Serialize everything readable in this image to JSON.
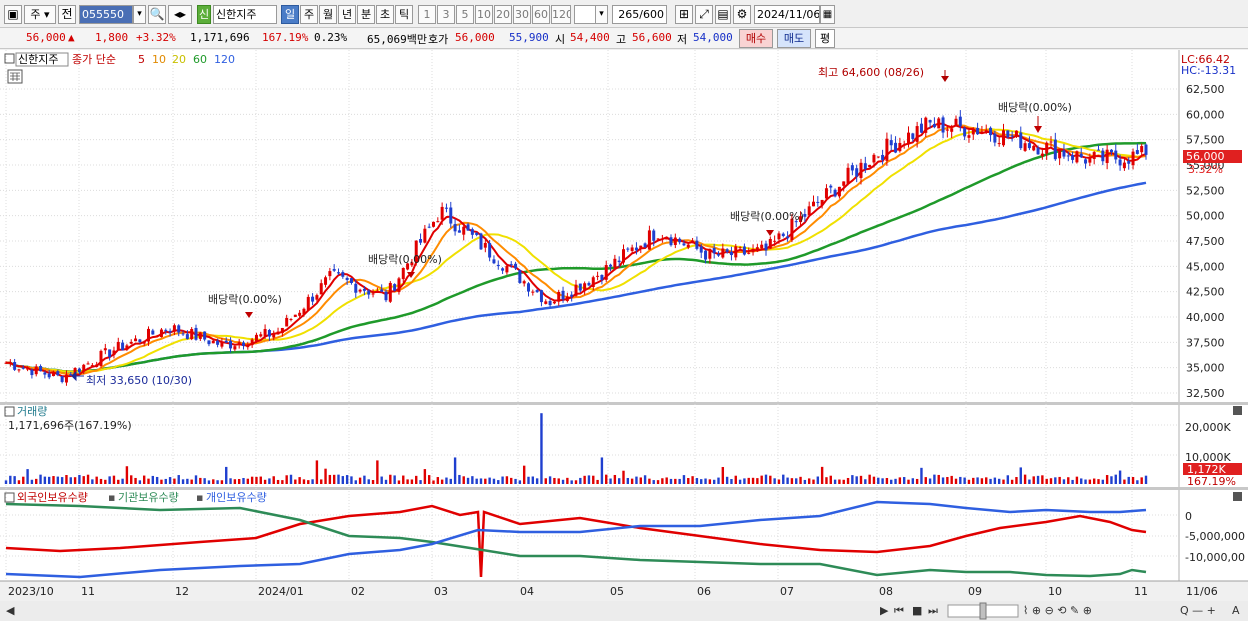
{
  "toolbar": {
    "period_toggle": "주",
    "prev_label": "전",
    "stock_code": "055550",
    "stock_badge": "신",
    "stock_name": "신한지주",
    "periods": [
      "일",
      "주",
      "월",
      "년",
      "분",
      "초",
      "틱"
    ],
    "minute_opts": [
      "1",
      "3",
      "5",
      "10",
      "20",
      "30",
      "60",
      "120"
    ],
    "count": "265",
    "count_total": "/600",
    "date": "2024/11/06"
  },
  "quote": {
    "price": "56,000",
    "arrow": "▲",
    "change": "1,800",
    "change_pct": "+3.32%",
    "volume": "1,171,696",
    "vol_ratio": "167.19%",
    "turnover_pct": "0.23%",
    "amount": "65,069백만",
    "bid_label": "호가",
    "ask": "56,000",
    "bid": "55,900",
    "open_label": "시",
    "open": "54,400",
    "high_label": "고",
    "high": "56,600",
    "low_label": "저",
    "low": "54,000",
    "buy": "매수",
    "sell": "매도",
    "eval": "평"
  },
  "panes": {
    "price": {
      "name": "신한지주",
      "indicator": "종가 단순",
      "ma_labels": [
        "5",
        "10",
        "20",
        "60",
        "120"
      ],
      "lc": "LC:66.42",
      "hc": "HC:-13.31",
      "last_price": "56,000",
      "last_pct": "3.32%",
      "annotations": {
        "high": "최고 64,600 (08/26)",
        "low": "최저 33,650 (10/30)",
        "dividends": [
          "배당락(0.00%)",
          "배당락(0.00%)",
          "배당락(0.00%)",
          "배당락(0.00%)"
        ]
      }
    },
    "volume": {
      "title": "거래량",
      "info": "1,171,696주(167.19%)",
      "last": "1,172K",
      "last_pct": "167.19%"
    },
    "holders": {
      "labels": [
        "외국인보유수량",
        "기관보유수량",
        "개인보유수량"
      ]
    }
  },
  "colors": {
    "up": "#e00000",
    "down": "#1f3fcf",
    "ma5": "#e00000",
    "ma10": "#ff8c00",
    "ma20": "#f0e000",
    "ma60": "#1f9a2a",
    "ma120": "#2f5fe0",
    "foreign": "#e00000",
    "inst": "#2e8b57",
    "indiv": "#2f5fe0"
  },
  "chart_data": [
    {
      "type": "candlestick",
      "title": "신한지주",
      "x_ticks": [
        "2023/10",
        "11",
        "12",
        "2024/01",
        "02",
        "03",
        "04",
        "05",
        "06",
        "07",
        "08",
        "09",
        "10",
        "11",
        "11/06"
      ],
      "y_ticks": [
        "32,500",
        "35,000",
        "37,500",
        "40,000",
        "42,500",
        "45,000",
        "47,500",
        "50,000",
        "52,500",
        "55,000",
        "57,500",
        "60,000",
        "62,500"
      ],
      "ylim": [
        32500,
        66000
      ],
      "series": [
        {
          "name": "close_anchor",
          "points": [
            [
              "2023/10",
              35500
            ],
            [
              "2023/11 mid",
              34000
            ],
            [
              "2023/12",
              36800
            ],
            [
              "2024/01",
              39000
            ],
            [
              "2024/01 mid",
              37200
            ],
            [
              "2024/02",
              38500
            ],
            [
              "2024/02 mid",
              44000
            ],
            [
              "2024/03",
              42000
            ],
            [
              "2024/03 mid",
              50500
            ],
            [
              "2024/04",
              46000
            ],
            [
              "2024/04 mid",
              41500
            ],
            [
              "2024/05",
              44500
            ],
            [
              "2024/05 mid",
              48500
            ],
            [
              "2024/06",
              46000
            ],
            [
              "2024/07",
              46500
            ],
            [
              "2024/07 mid",
              51500
            ],
            [
              "2024/08",
              56000
            ],
            [
              "2024/08 mid",
              59000
            ],
            [
              "2024/08 end",
              58500
            ],
            [
              "2024/09",
              57000
            ],
            [
              "2024/10",
              55500
            ],
            [
              "2024/11",
              56000
            ]
          ]
        }
      ]
    },
    {
      "type": "bar",
      "title": "거래량",
      "y_ticks": [
        "20,000K",
        "10,000K"
      ],
      "ylim": [
        0,
        25000000
      ],
      "notes": "peak ~24,000K in late March 2024"
    },
    {
      "type": "line",
      "title": "외국인보유수량 / 기관보유수량 / 개인보유수량",
      "y_ticks": [
        "0",
        "-5,000,000",
        "-10,000,000"
      ],
      "series": [
        {
          "name": "외국인보유수량"
        },
        {
          "name": "기관보유수량"
        },
        {
          "name": "개인보유수량"
        }
      ]
    }
  ]
}
